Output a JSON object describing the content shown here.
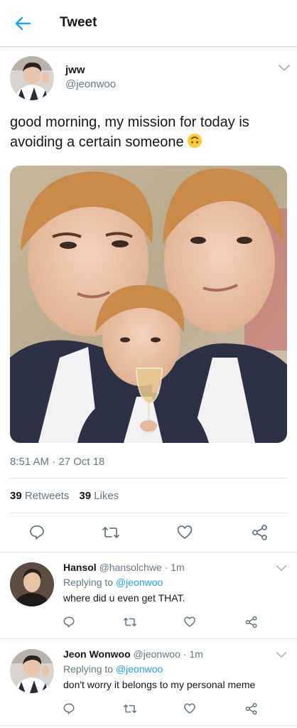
{
  "header": {
    "back_icon": "arrow-left-icon",
    "title": "Tweet",
    "accent": "#1da1f2"
  },
  "tweet": {
    "name": "jww",
    "handle": "@jeonwoo",
    "text": "good morning, my mission for today is avoiding a certain someone",
    "emoji": "upside-down-face-emoji",
    "timestamp": "8:51 AM · 27 Oct 18",
    "retweets_count": "39",
    "retweets_label": "Retweets",
    "likes_count": "39",
    "likes_label": "Likes",
    "actions": [
      "reply-icon",
      "retweet-icon",
      "like-icon",
      "share-icon"
    ]
  },
  "replies": [
    {
      "name": "Hansol",
      "handle": "@hansolchwe",
      "time": "· 1m",
      "replying_prefix": "Replying to",
      "replying_to": "@jeonwoo",
      "text": "where did u even get THAT."
    },
    {
      "name": "Jeon Wonwoo",
      "handle": "@jeonwoo",
      "time": "· 1m",
      "replying_prefix": "Replying to",
      "replying_to": "@jeonwoo",
      "text": "don't worry it belongs to my personal meme"
    }
  ]
}
